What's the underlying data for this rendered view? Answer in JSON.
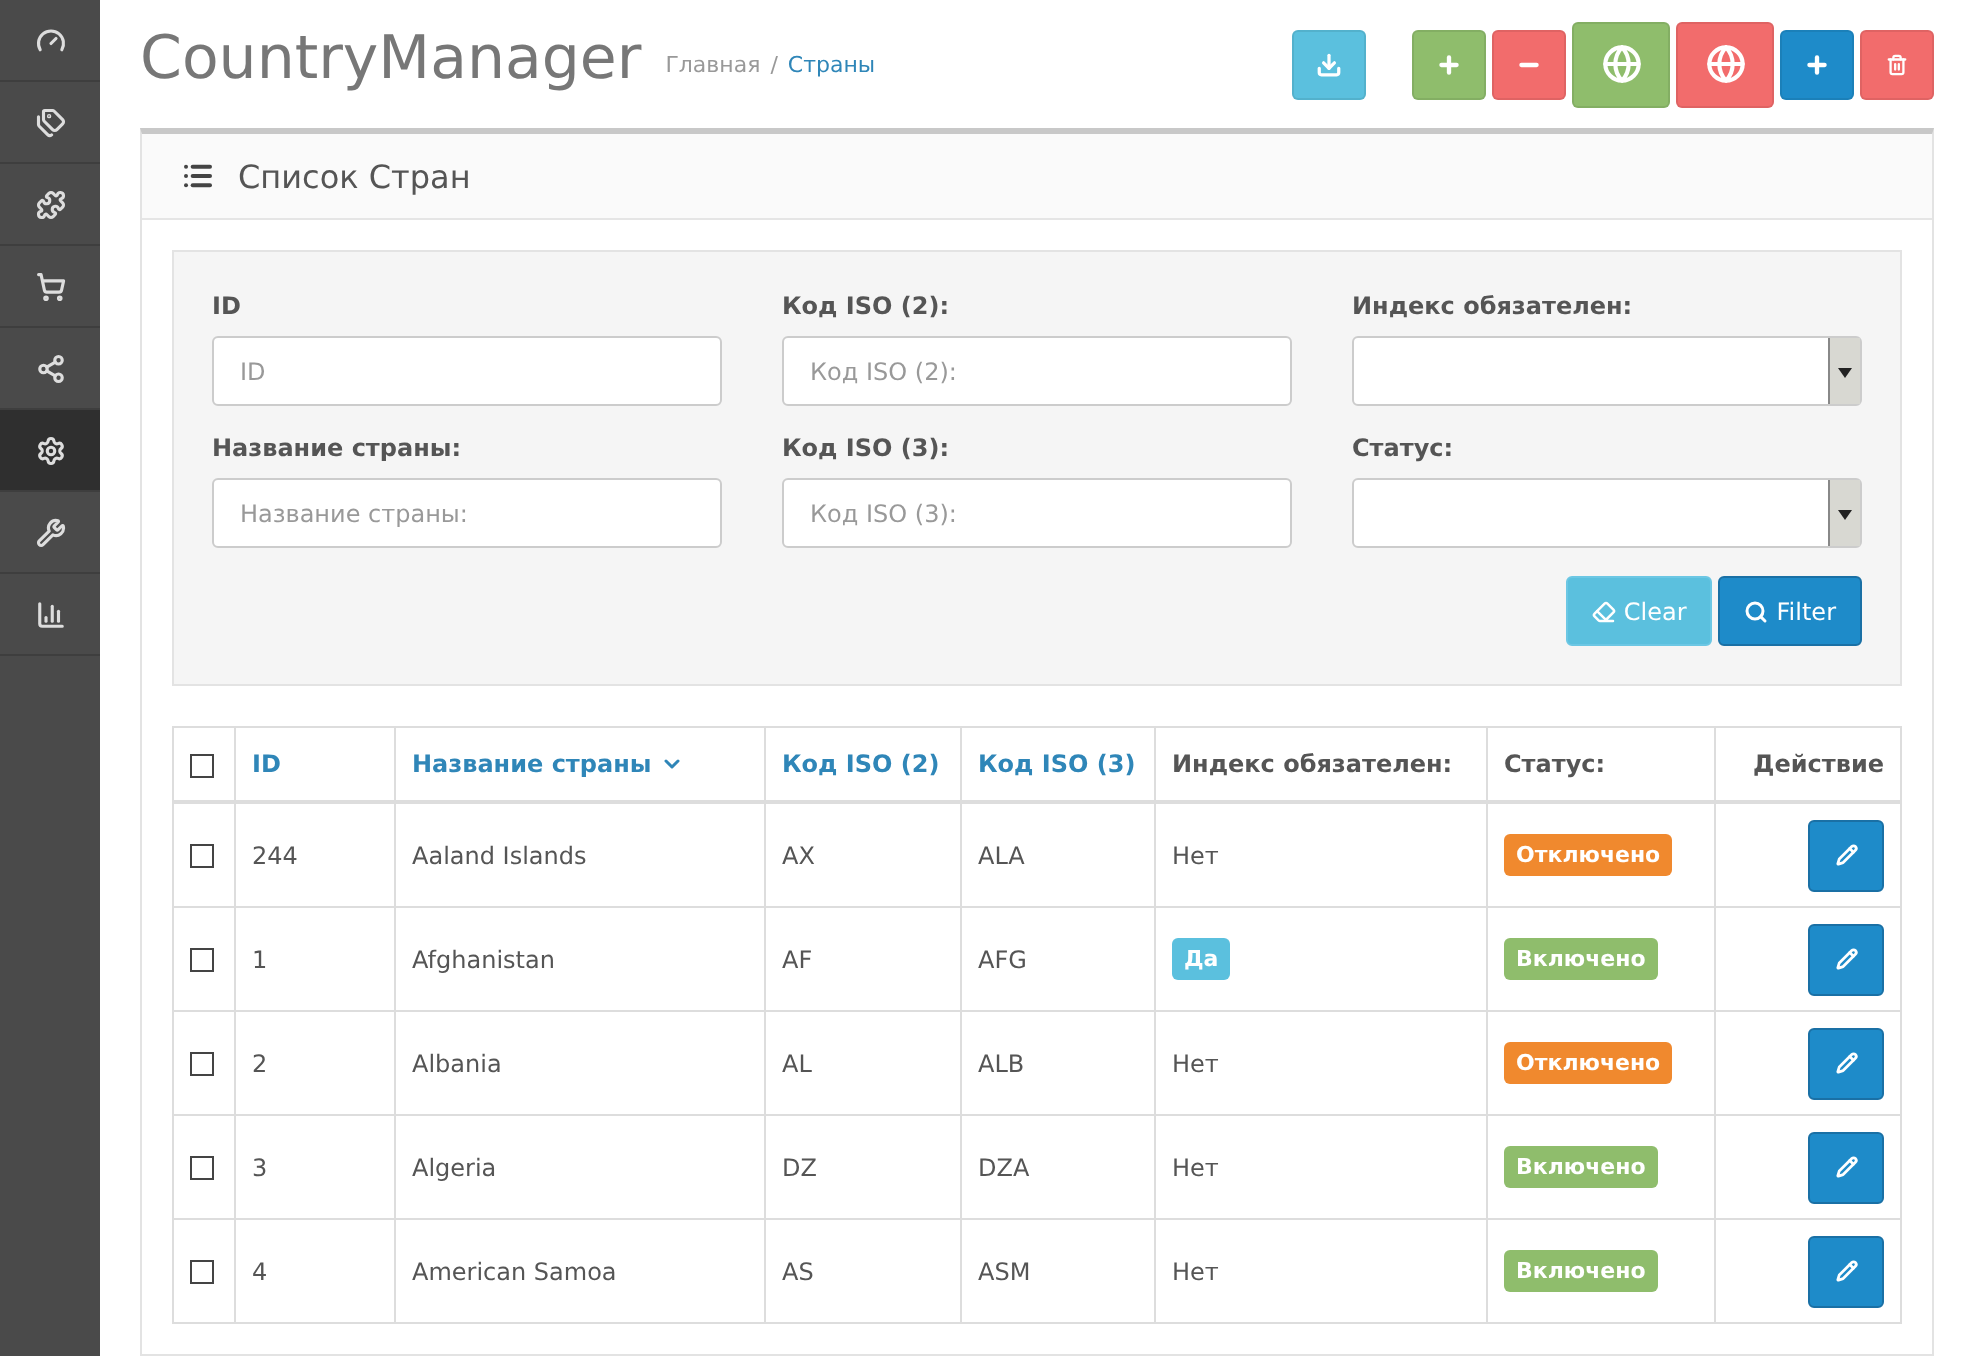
{
  "sidebar": {
    "items": [
      {
        "kind": "dashboard",
        "selected": false
      },
      {
        "kind": "tags",
        "selected": false
      },
      {
        "kind": "puzzle",
        "selected": false
      },
      {
        "kind": "cart",
        "selected": false
      },
      {
        "kind": "share",
        "selected": false
      },
      {
        "kind": "settings",
        "selected": true
      },
      {
        "kind": "wrench",
        "selected": false
      },
      {
        "kind": "chart",
        "selected": false
      }
    ]
  },
  "header": {
    "title": "CountryManager",
    "breadcrumb": [
      {
        "label": "Главная",
        "current": false
      },
      {
        "label": "Страны",
        "current": true
      }
    ],
    "breadcrumb_separator": "/",
    "toolbar": [
      {
        "kind": "download"
      },
      {
        "kind": "add"
      },
      {
        "kind": "remove"
      },
      {
        "kind": "globe-add"
      },
      {
        "kind": "globe-remove"
      },
      {
        "kind": "add-blue"
      },
      {
        "kind": "delete"
      }
    ]
  },
  "panel": {
    "title": "Список Стран",
    "filter": {
      "fields": [
        {
          "kind": "input",
          "label": "ID",
          "placeholder": "ID"
        },
        {
          "kind": "input",
          "label": "Код ISO (2):",
          "placeholder": "Код ISO (2):"
        },
        {
          "kind": "select",
          "label": "Индекс обязателен:"
        },
        {
          "kind": "input",
          "label": "Название страны:",
          "placeholder": "Название страны:"
        },
        {
          "kind": "input",
          "label": "Код ISO (3):",
          "placeholder": "Код ISO (3):"
        },
        {
          "kind": "select",
          "label": "Статус:"
        }
      ],
      "buttons": [
        {
          "kind": "clear",
          "label": "Clear"
        },
        {
          "kind": "filter",
          "label": "Filter"
        }
      ]
    },
    "table": {
      "select_all": {
        "checked": false
      },
      "columns": [
        {
          "label": "ID",
          "sortable": true
        },
        {
          "label": "Название страны",
          "sortable": true,
          "sorted": true
        },
        {
          "label": "Код ISO (2)",
          "sortable": true
        },
        {
          "label": "Код ISO (3)",
          "sortable": true
        },
        {
          "label": "Индекс обязателен:",
          "sortable": false
        },
        {
          "label": "Статус:",
          "sortable": false
        },
        {
          "label": "Действие",
          "sortable": false
        }
      ],
      "rows": [
        {
          "checked": false,
          "id": "244",
          "name": "Aaland Islands",
          "iso2": "AX",
          "iso3": "ALA",
          "postcode": {
            "text": "Нет",
            "required": false
          },
          "status": {
            "text": "Отключено",
            "enabled": false
          }
        },
        {
          "checked": false,
          "id": "1",
          "name": "Afghanistan",
          "iso2": "AF",
          "iso3": "AFG",
          "postcode": {
            "text": "Да",
            "required": true
          },
          "status": {
            "text": "Включено",
            "enabled": true
          }
        },
        {
          "checked": false,
          "id": "2",
          "name": "Albania",
          "iso2": "AL",
          "iso3": "ALB",
          "postcode": {
            "text": "Нет",
            "required": false
          },
          "status": {
            "text": "Отключено",
            "enabled": false
          }
        },
        {
          "checked": false,
          "id": "3",
          "name": "Algeria",
          "iso2": "DZ",
          "iso3": "DZA",
          "postcode": {
            "text": "Нет",
            "required": false
          },
          "status": {
            "text": "Включено",
            "enabled": true
          }
        },
        {
          "checked": false,
          "id": "4",
          "name": "American Samoa",
          "iso2": "AS",
          "iso3": "ASM",
          "postcode": {
            "text": "Нет",
            "required": false
          },
          "status": {
            "text": "Включено",
            "enabled": true
          }
        }
      ]
    }
  }
}
